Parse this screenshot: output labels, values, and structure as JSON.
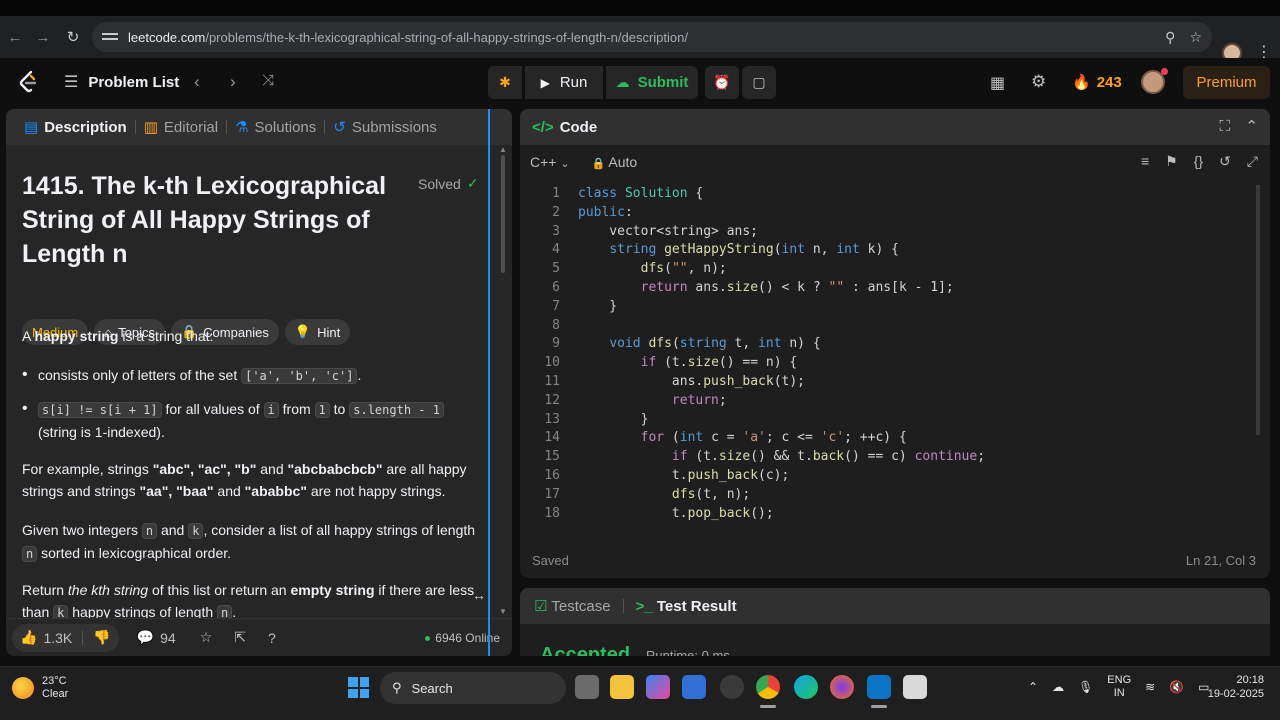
{
  "browser": {
    "url_host": "leetcode.com",
    "url_path": "/problems/the-k-th-lexicographical-string-of-all-happy-strings-of-length-n/description/"
  },
  "nav": {
    "problem_list_label": "Problem List",
    "run_label": "Run",
    "submit_label": "Submit",
    "streak_count": "243",
    "premium_label": "Premium"
  },
  "left_tabs": [
    "Description",
    "Editorial",
    "Solutions",
    "Submissions"
  ],
  "problem": {
    "title": "1415. The k-th Lexicographical String of All Happy Strings of Length n",
    "status": "Solved",
    "difficulty": "Medium",
    "chips": [
      "Topics",
      "Companies",
      "Hint"
    ],
    "intro_a": "A ",
    "intro_bold": "happy string",
    "intro_b": " is a string that:",
    "b1_text": "consists only of letters of the set ",
    "b1_code": "['a', 'b', 'c']",
    "b1_end": ".",
    "b2_code1": "s[i] != s[i + 1]",
    "b2_t1": " for all values of ",
    "b2_code2": "i",
    "b2_t2": " from ",
    "b2_code3": "1",
    "b2_t3": " to ",
    "b2_code4": "s.length - 1",
    "b2_t4": "(string is 1-indexed).",
    "ex_t1": "For example, strings ",
    "ex_b1": "\"abc\", \"ac\", \"b\"",
    "ex_t2": " and ",
    "ex_b2": "\"abcbabcbcb\"",
    "ex_t3": " are all happy strings and strings ",
    "ex_b3": "\"aa\", \"baa\"",
    "ex_t4": " and ",
    "ex_b4": "\"ababbc\"",
    "ex_t5": " are not happy strings.",
    "given_t1": "Given two integers ",
    "given_c1": "n",
    "given_t2": " and ",
    "given_c2": "k",
    "given_t3": ", consider a list of all happy strings of length ",
    "given_c3": "n",
    "given_t4": " sorted in lexicographical order.",
    "ret_t1": "Return ",
    "ret_i": "the kth string",
    "ret_t2": " of this list or return an ",
    "ret_b": "empty string",
    "ret_t3": " if there are less than ",
    "ret_c1": "k",
    "ret_t4": " happy strings of length ",
    "ret_c2": "n",
    "ret_t5": "."
  },
  "footer": {
    "likes": "1.3K",
    "comments": "94",
    "online": "6946 Online"
  },
  "code": {
    "title": "Code",
    "language": "C++",
    "mode": "Auto",
    "status_left": "Saved",
    "status_right": "Ln 21, Col 3",
    "line_numbers": [
      "1",
      "2",
      "3",
      "4",
      "5",
      "6",
      "7",
      "8",
      "9",
      "10",
      "11",
      "12",
      "13",
      "14",
      "15",
      "16",
      "17",
      "18"
    ]
  },
  "testpanel": {
    "tab1": "Testcase",
    "tab2": "Test Result",
    "result": "Accepted",
    "runtime": "Runtime: 0 ms"
  },
  "taskbar": {
    "temp": "23°C",
    "condition": "Clear",
    "search_label": "Search",
    "lang1": "ENG",
    "lang2": "IN",
    "time": "20:18",
    "date": "19-02-2025"
  }
}
